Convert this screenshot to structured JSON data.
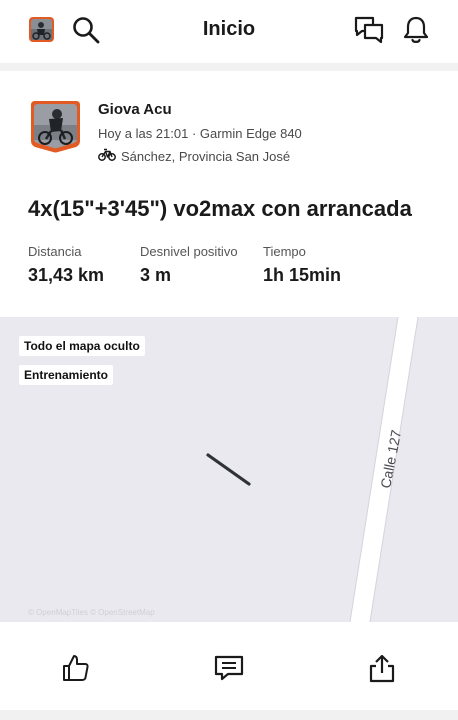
{
  "header": {
    "title": "Inicio",
    "left_icons": [
      "avatar",
      "search-icon"
    ],
    "right_icons": [
      "messages-icon",
      "bell-icon"
    ]
  },
  "activity": {
    "author": "Giova Acu",
    "meta": "Hoy a las 21:01 · Garmin Edge 840",
    "location": "Sánchez, Provincia San José",
    "sport_icon": "bike-icon",
    "title": "4x(15\"+3'45\") vo2max con arrancada",
    "stats": [
      {
        "label": "Distancia",
        "value": "31,43 km"
      },
      {
        "label": "Desnivel positivo",
        "value": "3 m"
      },
      {
        "label": "Tiempo",
        "value": "1h 15min"
      }
    ]
  },
  "map": {
    "chips": [
      "Todo el mapa oculto",
      "Entrenamiento"
    ],
    "street_label": "Calle 127",
    "attribution": "© OpenMapTiles © OpenStreetMap"
  },
  "actions": {
    "icons": [
      "thumbs-up-icon",
      "comment-icon",
      "share-icon"
    ]
  },
  "colors": {
    "accent": "#e35b24",
    "map_bg": "#e9e9ef"
  }
}
